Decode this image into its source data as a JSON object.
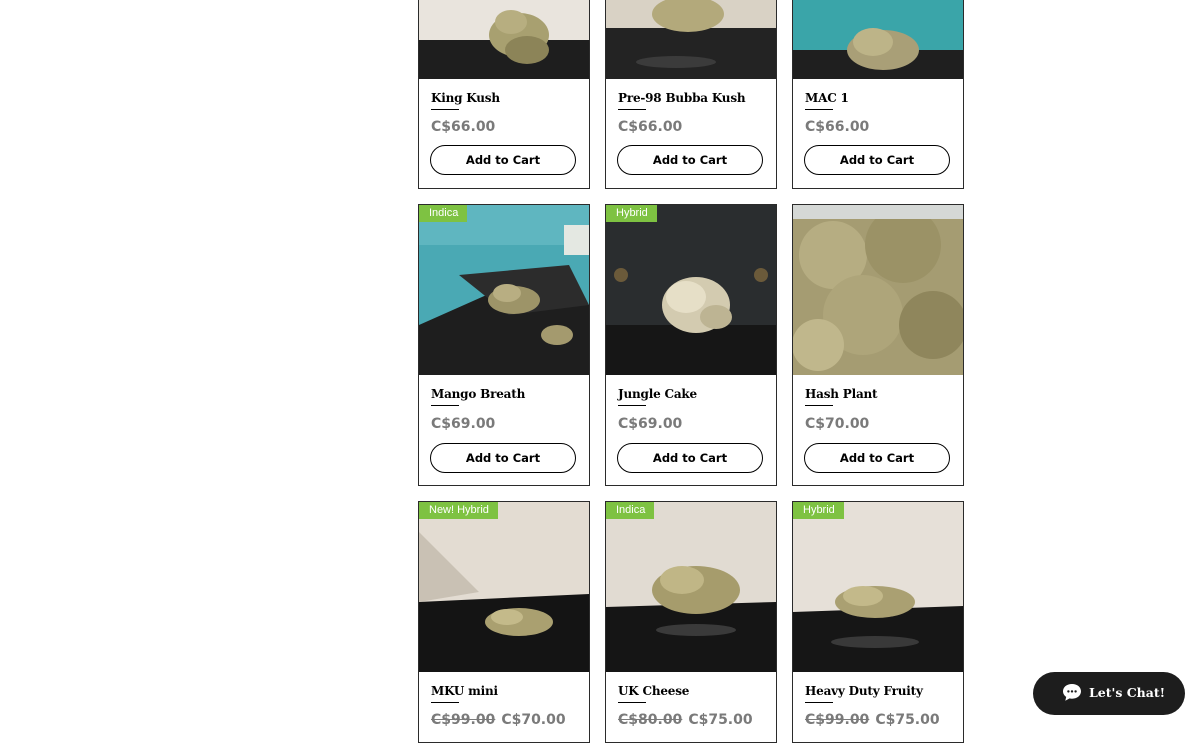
{
  "products": [
    {
      "name": "King Kush",
      "price": "C$66.00",
      "cta": "Add to Cart"
    },
    {
      "name": "Pre-98 Bubba Kush",
      "price": "C$66.00",
      "cta": "Add to Cart"
    },
    {
      "name": "MAC 1",
      "price": "C$66.00",
      "cta": "Add to Cart"
    },
    {
      "badge": "Indica",
      "name": "Mango Breath",
      "price": "C$69.00",
      "cta": "Add to Cart"
    },
    {
      "badge": "Hybrid",
      "name": "Jungle Cake",
      "price": "C$69.00",
      "cta": "Add to Cart"
    },
    {
      "name": "Hash Plant",
      "price": "C$70.00",
      "cta": "Add to Cart"
    },
    {
      "badge": "New! Hybrid",
      "name": "MKU mini",
      "old_price": "C$99.00",
      "price": "C$70.00"
    },
    {
      "badge": "Indica",
      "name": "UK Cheese",
      "old_price": "C$80.00",
      "price": "C$75.00"
    },
    {
      "badge": "Hybrid",
      "name": "Heavy Duty Fruity",
      "old_price": "C$99.00",
      "price": "C$75.00"
    }
  ],
  "chat_widget": {
    "label": "Let's Chat!",
    "icon": "chat-bubble-icon"
  },
  "colors": {
    "badge": "#7ec242",
    "price": "#7a7a7a",
    "chat_bg": "#1d1d1d"
  }
}
